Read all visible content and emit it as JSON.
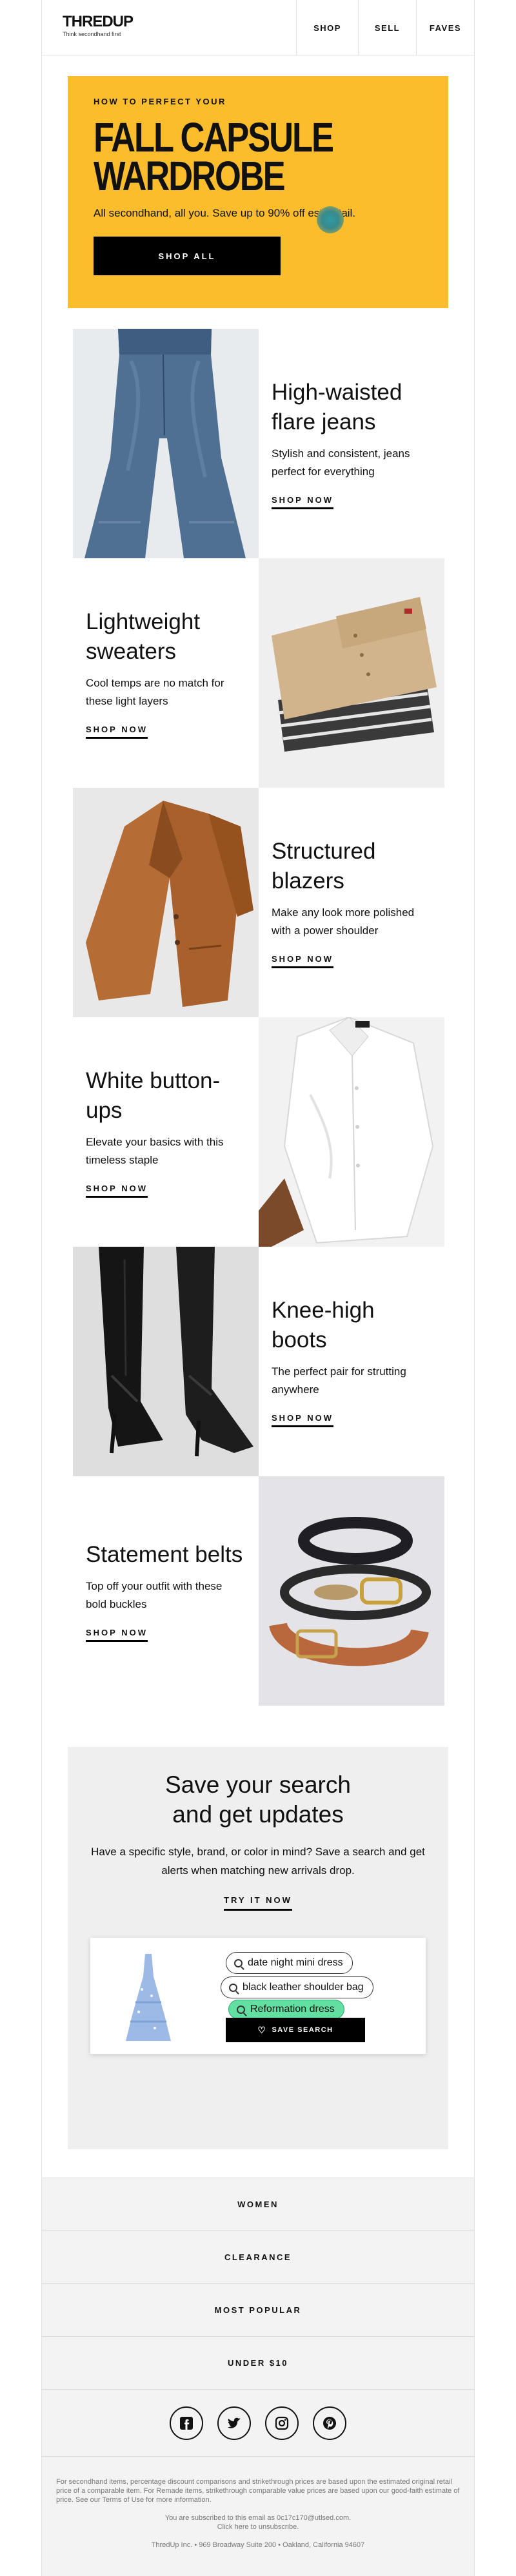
{
  "header": {
    "logo": "THREDUP",
    "tagline": "Think secondhand first",
    "nav": [
      "SHOP",
      "SELL",
      "FAVES"
    ]
  },
  "hero": {
    "eyebrow": "HOW TO PERFECT YOUR",
    "title_line1": "FALL CAPSULE",
    "title_line2": "WARDROBE",
    "subtitle": "All secondhand, all you. Save up to 90% off est. retail.",
    "cta": "SHOP ALL",
    "background_color": "#fbbd2b"
  },
  "products": [
    {
      "title": "High-waisted flare jeans",
      "description": "Stylish and consistent, jeans perfect for everything",
      "cta": "SHOP NOW",
      "image_icon": "flare-jeans-photo"
    },
    {
      "title": "Lightweight sweaters",
      "description": "Cool temps are no match for these light layers",
      "cta": "SHOP NOW",
      "image_icon": "folded-sweaters-photo"
    },
    {
      "title": "Structured blazers",
      "description": "Make any look more polished with a power shoulder",
      "cta": "SHOP NOW",
      "image_icon": "leather-blazer-photo"
    },
    {
      "title": "White button-ups",
      "description": "Elevate your basics with this timeless staple",
      "cta": "SHOP NOW",
      "image_icon": "white-shirt-photo"
    },
    {
      "title": "Knee-high boots",
      "description": "The perfect pair for strutting anywhere",
      "cta": "SHOP NOW",
      "image_icon": "knee-high-boots-photo"
    },
    {
      "title": "Statement belts",
      "description": "Top off your outfit with these bold buckles",
      "cta": "SHOP NOW",
      "image_icon": "belts-photo"
    }
  ],
  "save_search": {
    "title": "Save your search and get updates",
    "description": "Have a specific style, brand, or color in mind? Save a search and get alerts when matching new arrivals drop.",
    "cta": "TRY IT NOW",
    "pills": [
      "date night mini dress",
      "black leather shoulder bag",
      "Reformation dress"
    ],
    "button": "SAVE SEARCH"
  },
  "footer_nav": [
    "WOMEN",
    "CLEARANCE",
    "MOST POPULAR",
    "UNDER $10"
  ],
  "social": [
    "facebook-icon",
    "twitter-icon",
    "instagram-icon",
    "pinterest-icon"
  ],
  "legal": {
    "disclaimer": "For secondhand items, percentage discount comparisons and strikethrough prices are based upon the estimated original retail price of a comparable item. For Remade items, strikethrough comparable value prices are based upon our good-faith estimate of price. See our Terms of Use for more information.",
    "subscribed": "You are subscribed to this email as 0c17c170@utlsed.com.",
    "unsubscribe": "Click here to unsubscribe.",
    "address": "ThredUp Inc. • 969 Broadway Suite 200 • Oakland, California 94607"
  }
}
